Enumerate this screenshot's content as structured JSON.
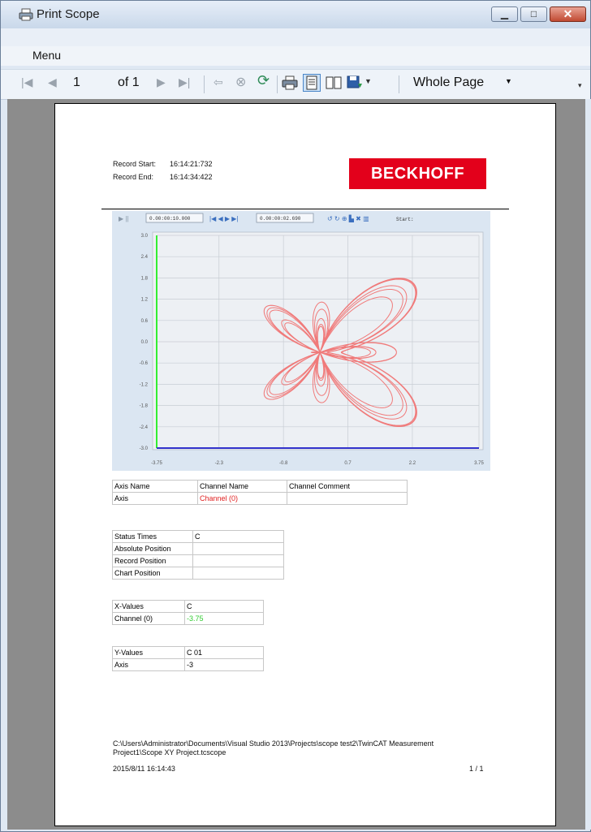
{
  "window": {
    "title": "Print Scope",
    "icon": "printer-icon"
  },
  "menu": {
    "items": [
      "Menu"
    ]
  },
  "toolbar": {
    "page_current": "1",
    "page_of": "of 1",
    "zoom": "Whole Page"
  },
  "report": {
    "record_start_label": "Record Start:",
    "record_start_value": "16:14:21:732",
    "record_end_label": "Record End:",
    "record_end_value": "16:14:34:422",
    "logo_text": "BECKHOFF",
    "scope_toolbar": {
      "time1": "0.00:00:10.000",
      "time2": "0.00:00:02.690",
      "start_label": "Start:"
    },
    "channel_table": {
      "headers": [
        "Axis Name",
        "Channel Name",
        "Channel Comment"
      ],
      "rows": [
        [
          "Axis",
          "Channel (0)",
          ""
        ]
      ]
    },
    "status_table": {
      "header": [
        "Status Times",
        "C"
      ],
      "rows": [
        [
          "Absolute Position",
          ""
        ],
        [
          "Record Position",
          ""
        ],
        [
          "Chart Position",
          ""
        ]
      ]
    },
    "x_values_table": {
      "header": [
        "X-Values",
        "C"
      ],
      "rows": [
        [
          "Channel (0)",
          "-3.75"
        ]
      ]
    },
    "y_values_table": {
      "header": [
        "Y-Values",
        "C 01"
      ],
      "rows": [
        [
          "Axis",
          "-3"
        ]
      ]
    },
    "footer_path_line1": "C:\\Users\\Administrator\\Documents\\Visual Studio 2013\\Projects\\scope test2\\TwinCAT Measurement",
    "footer_path_line2": "Project1\\Scope XY Project.tcscope",
    "footer_date": "2015/8/11 16:14:43",
    "footer_page": "1 / 1"
  },
  "chart_data": {
    "type": "line",
    "x_ticks": [
      "-3.75",
      "-2.3",
      "-0.8",
      "0.7",
      "2.2",
      "3.75"
    ],
    "y_ticks": [
      "3.0",
      "2.4",
      "1.8",
      "1.2",
      "0.6",
      "0.0",
      "-0.6",
      "-1.2",
      "-1.8",
      "-2.4",
      "-3.0"
    ],
    "xlim": [
      -3.75,
      3.75
    ],
    "ylim": [
      -3.0,
      3.0
    ],
    "grid": true,
    "series": [
      {
        "name": "Channel (0)",
        "color": "#f07a7a",
        "shape": "butterfly curve"
      }
    ],
    "axis_colors": {
      "y_axis": "#33ee33",
      "x_axis": "#3333cc"
    }
  },
  "colors": {
    "logo_red": "#e3001b",
    "curve": "#f07a7a",
    "channel_red": "#e02020",
    "value_green": "#33cc33"
  }
}
